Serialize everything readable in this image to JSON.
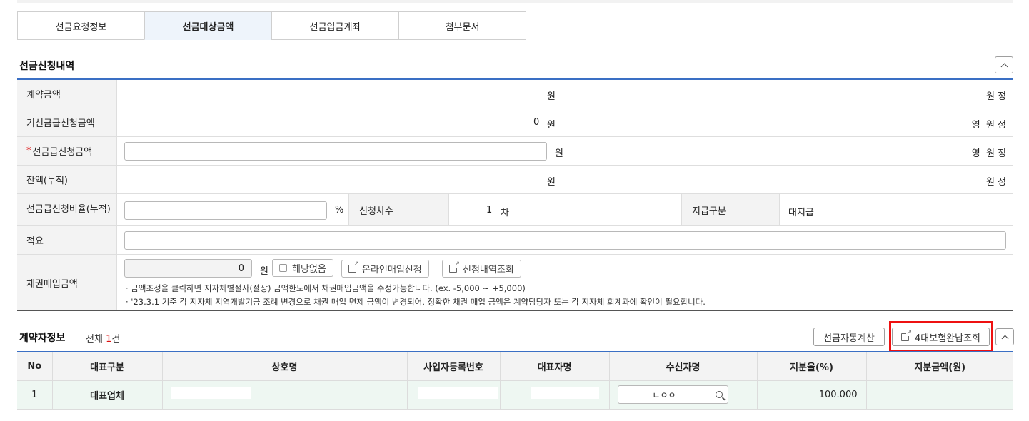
{
  "tabs": [
    "선금요청정보",
    "선금대상금액",
    "선금입금계좌",
    "첨부문서"
  ],
  "active_tab": 1,
  "section1": {
    "title": "선금신청내역",
    "rows": {
      "contract_amount": {
        "label": "계약금액",
        "value": "",
        "unit": "원",
        "right": "원 정"
      },
      "prev_advance": {
        "label": "기선금급신청금액",
        "value": "0",
        "unit": "원",
        "right": "영  원 정"
      },
      "advance_amount": {
        "label": "선금급신청금액",
        "required": "*",
        "value": "",
        "unit": "원",
        "right": "영  원 정"
      },
      "balance": {
        "label": "잔액(누적)",
        "value": "",
        "unit": "원",
        "right": "원 정"
      },
      "ratio": {
        "label": "선금급신청비율(누적)",
        "unit": "%",
        "round_label": "신청차수",
        "round_value": "1",
        "round_unit": "차",
        "pay_label": "지급구분",
        "pay_value": "대지급"
      },
      "summary": {
        "label": "적요",
        "value": ""
      },
      "bond": {
        "label": "채권매입금액",
        "value": "0",
        "unit": "원",
        "none_label": "해당없음",
        "online_btn": "온라인매입신청",
        "history_btn": "신청내역조회",
        "note1": "·  금액조정을 클릭하면 지자체별절사(절상) 금액한도에서 채권매입금액을 수정가능합니다. (ex. -5,000 ~ +5,000)",
        "note2": "·  '23.3.1 기준 각 지자체 지역개발기금 조례 변경으로 채권 매입 면제 금액이 변경되어, 정확한 채권 매입 금액은 계약담당자 또는 각 지자체 회계과에 확인이 필요합니다."
      }
    }
  },
  "section2": {
    "title": "계약자정보",
    "count_prefix": "전체 ",
    "count_num": "1",
    "count_suffix": "건",
    "auto_calc_btn": "선금자동계산",
    "insurance_btn": "4대보험완납조회",
    "columns": [
      "No",
      "대표구분",
      "상호명",
      "사업자등록번호",
      "대표자명",
      "수신자명",
      "지분율(%)",
      "지분금액(원)"
    ],
    "rows": [
      {
        "no": "1",
        "type": "대표업체",
        "receiver": "ㄴㅇㅇ",
        "share": "100.000",
        "amount": ""
      }
    ]
  },
  "colors": {
    "accent": "#3a6fc4",
    "highlight": "#e11111",
    "required": "#d11111"
  }
}
